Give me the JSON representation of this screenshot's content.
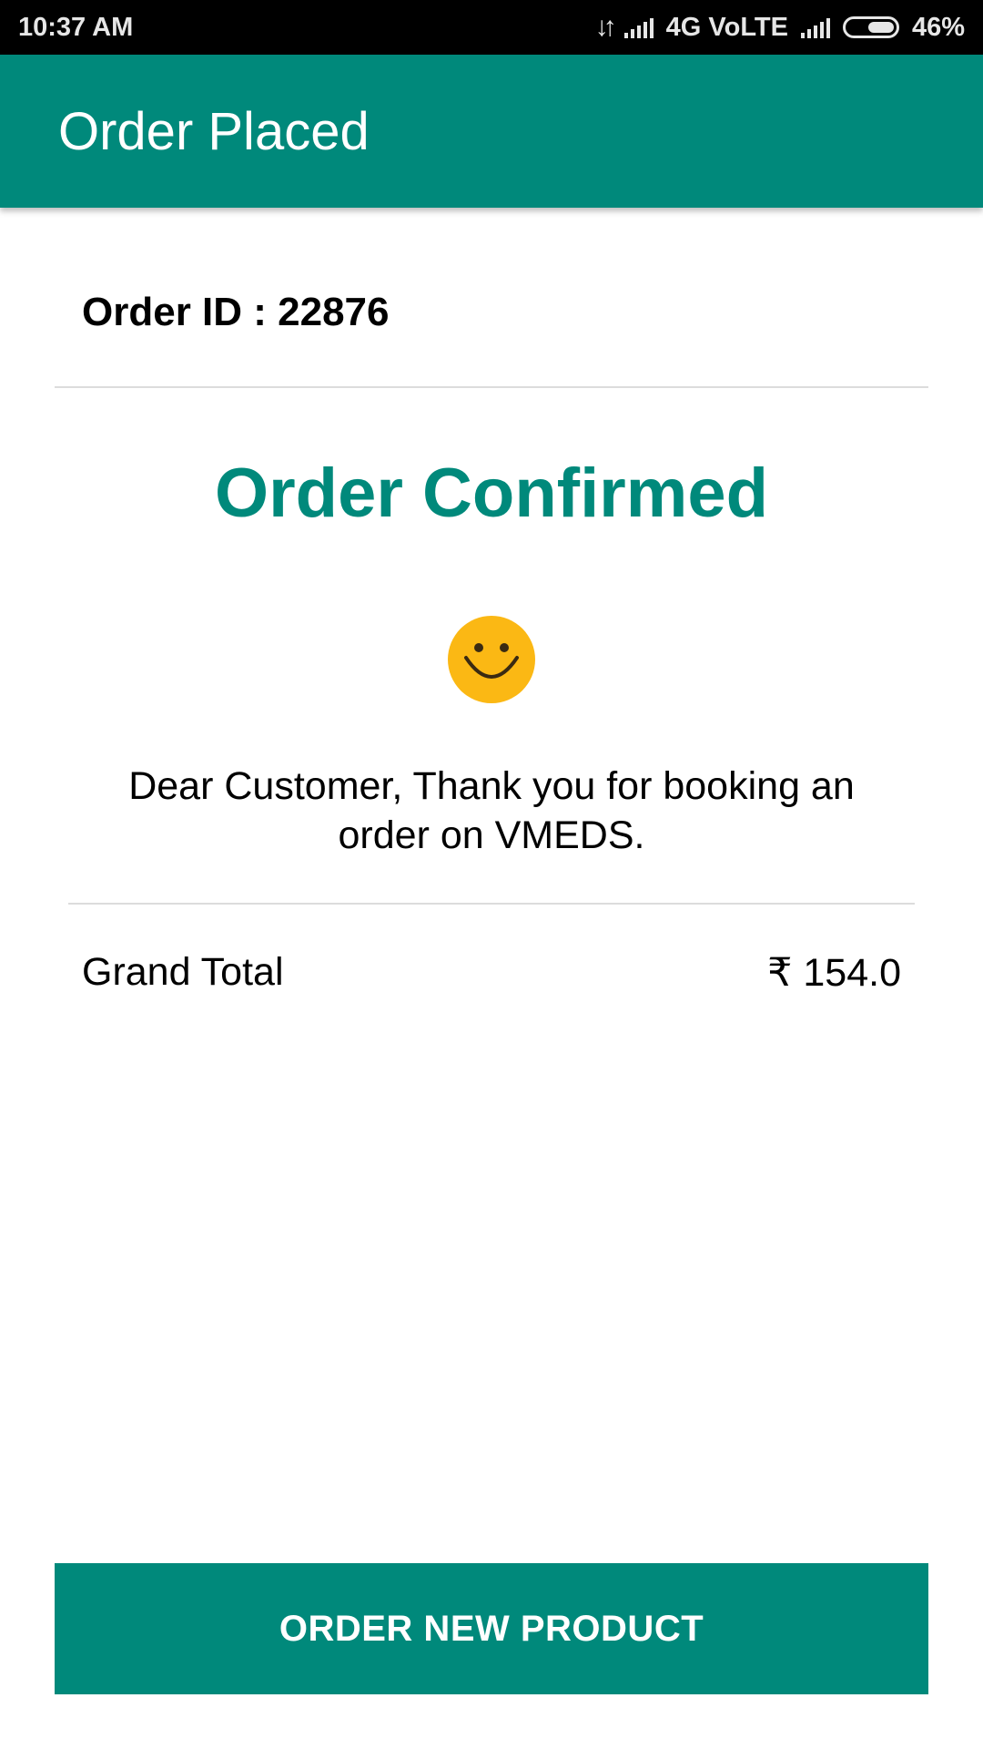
{
  "status_bar": {
    "time": "10:37 AM",
    "network": "4G VoLTE",
    "battery": "46%",
    "battery_level": 0.46,
    "icons": [
      "data-transfer-icon",
      "signal-icon",
      "signal-icon",
      "battery-icon"
    ]
  },
  "app_bar": {
    "title": "Order Placed"
  },
  "order": {
    "id_text": "Order ID : 22876",
    "status_heading": "Order Confirmed",
    "status_icon": "smiley-icon",
    "message": "Dear Customer, Thank you for booking an order on VMEDS.",
    "grand_total_label": "Grand Total",
    "grand_total_value": "₹ 154.0"
  },
  "actions": {
    "order_new_label": "ORDER NEW PRODUCT"
  },
  "colors": {
    "primary": "#00897b",
    "smiley": "#fbb814"
  }
}
